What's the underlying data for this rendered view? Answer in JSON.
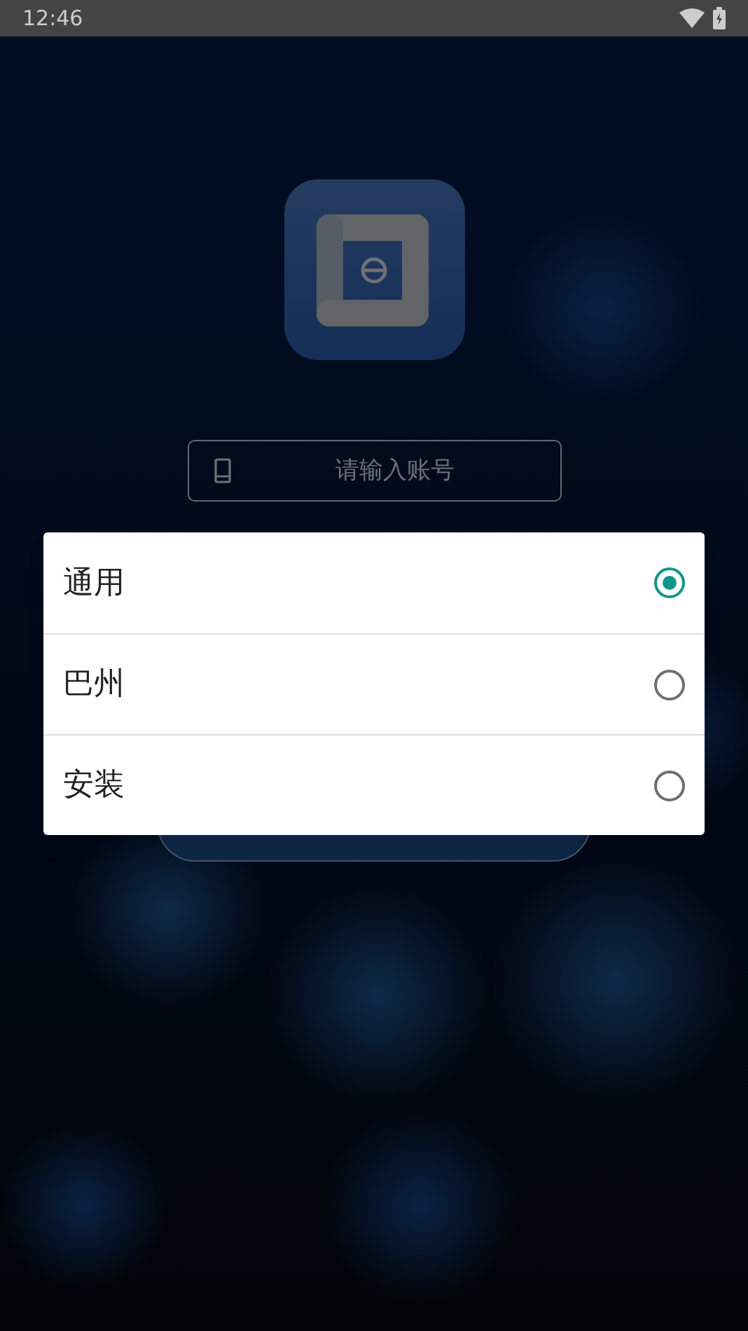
{
  "status_bar": {
    "time": "12:46"
  },
  "login": {
    "account_field": {
      "placeholder": "请输入账号"
    }
  },
  "dialog": {
    "options": [
      {
        "label": "通用",
        "selected": true
      },
      {
        "label": "巴州",
        "selected": false
      },
      {
        "label": "安装",
        "selected": false
      }
    ]
  }
}
